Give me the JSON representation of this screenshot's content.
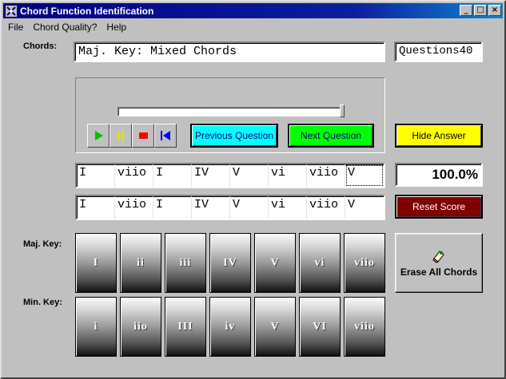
{
  "window": {
    "title": "Chord Function Identification",
    "minimize": "_",
    "maximize": "□",
    "close": "×"
  },
  "menu": [
    "File",
    "Chord Quality?",
    "Help"
  ],
  "chords_label": "Chords:",
  "chords_value": "Maj. Key: Mixed Chords",
  "questions_value": "Questions40",
  "player": {
    "progress": 0.98,
    "play_icon": "play-icon",
    "pause_icon": "pause-icon",
    "stop_icon": "stop-icon",
    "rewind_icon": "skip-back-icon"
  },
  "buttons": {
    "previous": "Previous Question",
    "next": "Next Question",
    "hide_answer": "Hide Answer",
    "reset_score": "Reset Score",
    "erase_all": "Erase All Chords"
  },
  "answer_row": [
    "I",
    "viio",
    "I",
    "IV",
    "V",
    "vi",
    "viio",
    "V"
  ],
  "solution_row": [
    "I",
    "viio",
    "I",
    "IV",
    "V",
    "vi",
    "viio",
    "V"
  ],
  "score": "100.0%",
  "major_key": {
    "label": "Maj. Key:",
    "chords": [
      "I",
      "ii",
      "iii",
      "IV",
      "V",
      "vi",
      "viio"
    ]
  },
  "minor_key": {
    "label": "Min. Key:",
    "chords": [
      "i",
      "iio",
      "III",
      "iv",
      "V",
      "VI",
      "viio"
    ]
  },
  "colors": {
    "previous": "#00ffff",
    "next": "#00ff00",
    "hide": "#ffff00",
    "reset": "#800000",
    "title_bar": "#000080"
  }
}
